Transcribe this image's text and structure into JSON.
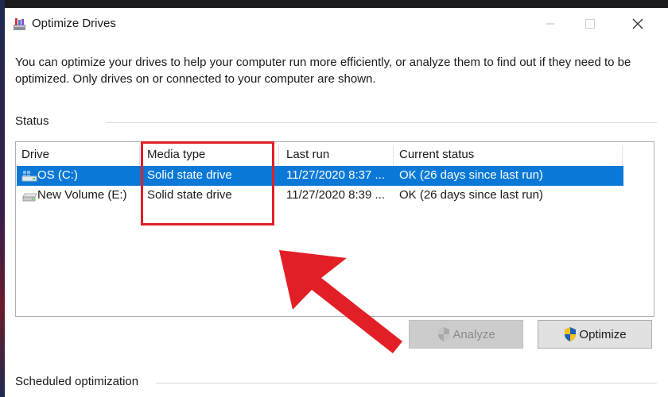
{
  "window": {
    "title": "Optimize Drives",
    "description": "You can optimize your drives to help your computer run more efficiently, or analyze them to find out if they need to be optimized. Only drives on or connected to your computer are shown."
  },
  "status_section": {
    "label": "Status"
  },
  "drive_list": {
    "columns": [
      "Drive",
      "Media type",
      "Last run",
      "Current status"
    ],
    "rows": [
      {
        "drive": "OS (C:)",
        "media_type": "Solid state drive",
        "last_run": "11/27/2020 8:37 ...",
        "current_status": "OK (26 days since last run)",
        "selected": true,
        "icon": "os-drive-icon"
      },
      {
        "drive": "New Volume (E:)",
        "media_type": "Solid state drive",
        "last_run": "11/27/2020 8:39 ...",
        "current_status": "OK (26 days since last run)",
        "selected": false,
        "icon": "disk-drive-icon"
      }
    ]
  },
  "buttons": {
    "analyze": "Analyze",
    "optimize": "Optimize",
    "analyze_enabled": false
  },
  "scheduled_section": {
    "label": "Scheduled optimization"
  },
  "annotation": {
    "highlight_color": "#e21f26",
    "arrow_color": "#e21f26"
  },
  "colors": {
    "selection": "#0a78d7"
  }
}
